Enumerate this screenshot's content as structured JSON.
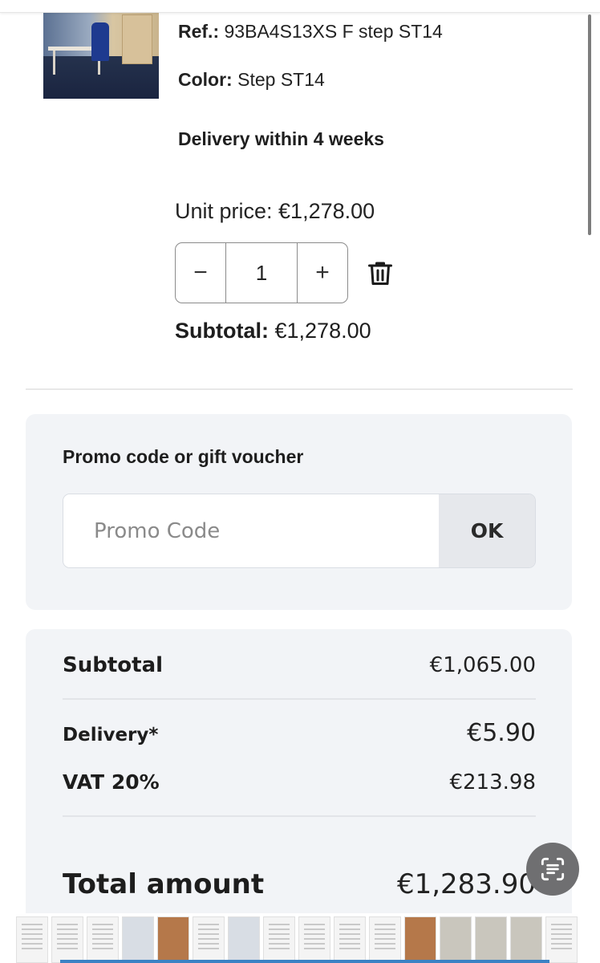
{
  "product": {
    "ref_label": "Ref.:",
    "ref_value": "93BA4S13XS F step ST14",
    "color_label": "Color:",
    "color_value": "Step ST14",
    "delivery_note": "Delivery within 4 weeks",
    "unit_price": "Unit price: €1,278.00",
    "quantity": "1",
    "decrement": "−",
    "increment": "+",
    "subtotal_label": "Subtotal:",
    "subtotal_value": "€1,278.00"
  },
  "promo": {
    "title": "Promo code or gift voucher",
    "placeholder": "Promo Code",
    "button": "OK"
  },
  "summary": {
    "subtotal_label": "Subtotal",
    "subtotal_value": "€1,065.00",
    "delivery_label": "Delivery*",
    "delivery_value": "€5.90",
    "vat_label": "VAT 20%",
    "vat_value": "€213.98",
    "total_label": "Total amount",
    "total_value": "€1,283.90"
  },
  "icons": {
    "trash": "trash-icon",
    "scan": "scan-text-icon"
  },
  "colors": {
    "panel_bg": "#f2f4f7",
    "ok_bg": "#e6e8ec",
    "border": "#8b8b8b"
  }
}
